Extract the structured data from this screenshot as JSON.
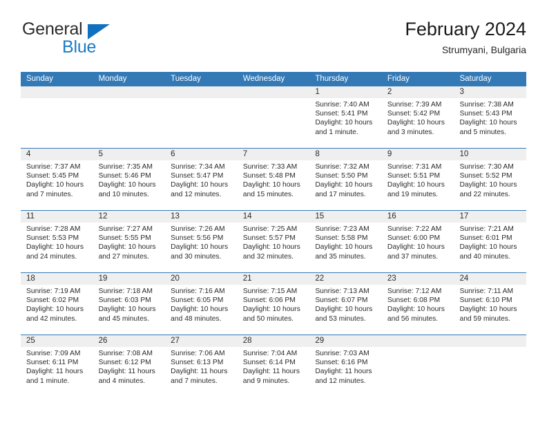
{
  "brand": {
    "name_top": "General",
    "name_bottom": "Blue",
    "triangle_color": "#1271bf",
    "blue_color": "#1b7ac4"
  },
  "header": {
    "title": "February 2024",
    "subtitle": "Strumyani, Bulgaria"
  },
  "theme": {
    "header_blue": "#3279b6",
    "date_strip_gray": "#efefef",
    "text_color": "#2a2a2a"
  },
  "weekdays": [
    "Sunday",
    "Monday",
    "Tuesday",
    "Wednesday",
    "Thursday",
    "Friday",
    "Saturday"
  ],
  "weeks": [
    [
      {
        "empty": true
      },
      {
        "empty": true
      },
      {
        "empty": true
      },
      {
        "empty": true
      },
      {
        "day": "1",
        "sunrise": "Sunrise: 7:40 AM",
        "sunset": "Sunset: 5:41 PM",
        "daylight": "Daylight: 10 hours and 1 minute."
      },
      {
        "day": "2",
        "sunrise": "Sunrise: 7:39 AM",
        "sunset": "Sunset: 5:42 PM",
        "daylight": "Daylight: 10 hours and 3 minutes."
      },
      {
        "day": "3",
        "sunrise": "Sunrise: 7:38 AM",
        "sunset": "Sunset: 5:43 PM",
        "daylight": "Daylight: 10 hours and 5 minutes."
      }
    ],
    [
      {
        "day": "4",
        "sunrise": "Sunrise: 7:37 AM",
        "sunset": "Sunset: 5:45 PM",
        "daylight": "Daylight: 10 hours and 7 minutes."
      },
      {
        "day": "5",
        "sunrise": "Sunrise: 7:35 AM",
        "sunset": "Sunset: 5:46 PM",
        "daylight": "Daylight: 10 hours and 10 minutes."
      },
      {
        "day": "6",
        "sunrise": "Sunrise: 7:34 AM",
        "sunset": "Sunset: 5:47 PM",
        "daylight": "Daylight: 10 hours and 12 minutes."
      },
      {
        "day": "7",
        "sunrise": "Sunrise: 7:33 AM",
        "sunset": "Sunset: 5:48 PM",
        "daylight": "Daylight: 10 hours and 15 minutes."
      },
      {
        "day": "8",
        "sunrise": "Sunrise: 7:32 AM",
        "sunset": "Sunset: 5:50 PM",
        "daylight": "Daylight: 10 hours and 17 minutes."
      },
      {
        "day": "9",
        "sunrise": "Sunrise: 7:31 AM",
        "sunset": "Sunset: 5:51 PM",
        "daylight": "Daylight: 10 hours and 19 minutes."
      },
      {
        "day": "10",
        "sunrise": "Sunrise: 7:30 AM",
        "sunset": "Sunset: 5:52 PM",
        "daylight": "Daylight: 10 hours and 22 minutes."
      }
    ],
    [
      {
        "day": "11",
        "sunrise": "Sunrise: 7:28 AM",
        "sunset": "Sunset: 5:53 PM",
        "daylight": "Daylight: 10 hours and 24 minutes."
      },
      {
        "day": "12",
        "sunrise": "Sunrise: 7:27 AM",
        "sunset": "Sunset: 5:55 PM",
        "daylight": "Daylight: 10 hours and 27 minutes."
      },
      {
        "day": "13",
        "sunrise": "Sunrise: 7:26 AM",
        "sunset": "Sunset: 5:56 PM",
        "daylight": "Daylight: 10 hours and 30 minutes."
      },
      {
        "day": "14",
        "sunrise": "Sunrise: 7:25 AM",
        "sunset": "Sunset: 5:57 PM",
        "daylight": "Daylight: 10 hours and 32 minutes."
      },
      {
        "day": "15",
        "sunrise": "Sunrise: 7:23 AM",
        "sunset": "Sunset: 5:58 PM",
        "daylight": "Daylight: 10 hours and 35 minutes."
      },
      {
        "day": "16",
        "sunrise": "Sunrise: 7:22 AM",
        "sunset": "Sunset: 6:00 PM",
        "daylight": "Daylight: 10 hours and 37 minutes."
      },
      {
        "day": "17",
        "sunrise": "Sunrise: 7:21 AM",
        "sunset": "Sunset: 6:01 PM",
        "daylight": "Daylight: 10 hours and 40 minutes."
      }
    ],
    [
      {
        "day": "18",
        "sunrise": "Sunrise: 7:19 AM",
        "sunset": "Sunset: 6:02 PM",
        "daylight": "Daylight: 10 hours and 42 minutes."
      },
      {
        "day": "19",
        "sunrise": "Sunrise: 7:18 AM",
        "sunset": "Sunset: 6:03 PM",
        "daylight": "Daylight: 10 hours and 45 minutes."
      },
      {
        "day": "20",
        "sunrise": "Sunrise: 7:16 AM",
        "sunset": "Sunset: 6:05 PM",
        "daylight": "Daylight: 10 hours and 48 minutes."
      },
      {
        "day": "21",
        "sunrise": "Sunrise: 7:15 AM",
        "sunset": "Sunset: 6:06 PM",
        "daylight": "Daylight: 10 hours and 50 minutes."
      },
      {
        "day": "22",
        "sunrise": "Sunrise: 7:13 AM",
        "sunset": "Sunset: 6:07 PM",
        "daylight": "Daylight: 10 hours and 53 minutes."
      },
      {
        "day": "23",
        "sunrise": "Sunrise: 7:12 AM",
        "sunset": "Sunset: 6:08 PM",
        "daylight": "Daylight: 10 hours and 56 minutes."
      },
      {
        "day": "24",
        "sunrise": "Sunrise: 7:11 AM",
        "sunset": "Sunset: 6:10 PM",
        "daylight": "Daylight: 10 hours and 59 minutes."
      }
    ],
    [
      {
        "day": "25",
        "sunrise": "Sunrise: 7:09 AM",
        "sunset": "Sunset: 6:11 PM",
        "daylight": "Daylight: 11 hours and 1 minute."
      },
      {
        "day": "26",
        "sunrise": "Sunrise: 7:08 AM",
        "sunset": "Sunset: 6:12 PM",
        "daylight": "Daylight: 11 hours and 4 minutes."
      },
      {
        "day": "27",
        "sunrise": "Sunrise: 7:06 AM",
        "sunset": "Sunset: 6:13 PM",
        "daylight": "Daylight: 11 hours and 7 minutes."
      },
      {
        "day": "28",
        "sunrise": "Sunrise: 7:04 AM",
        "sunset": "Sunset: 6:14 PM",
        "daylight": "Daylight: 11 hours and 9 minutes."
      },
      {
        "day": "29",
        "sunrise": "Sunrise: 7:03 AM",
        "sunset": "Sunset: 6:16 PM",
        "daylight": "Daylight: 11 hours and 12 minutes."
      },
      {
        "empty": true
      },
      {
        "empty": true
      }
    ]
  ]
}
